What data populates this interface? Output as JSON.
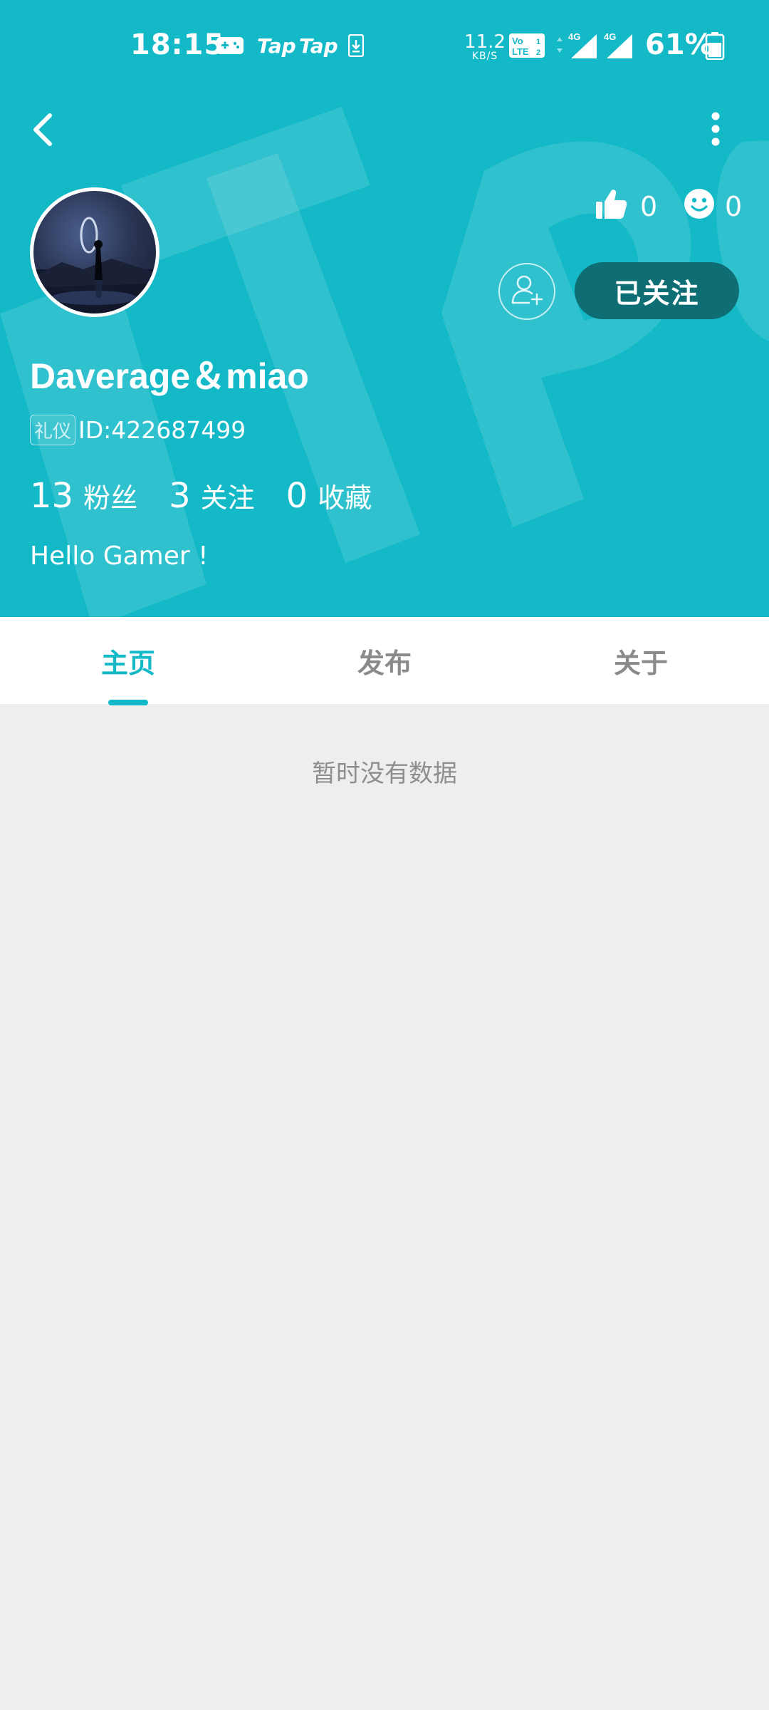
{
  "status_bar": {
    "time": "18:15",
    "notification_icons": [
      "gamepad-icon",
      "taptap-icon",
      "taptap-icon",
      "download-icon"
    ],
    "tap_label": "Tap",
    "net_speed_value": "11.2",
    "net_speed_unit": "KB/S",
    "network": "4G",
    "battery": "61%"
  },
  "nav": {
    "back_icon": "chevron-left-icon",
    "more_icon": "more-vertical-icon"
  },
  "profile": {
    "likes_count": "0",
    "smiles_count": "0",
    "follow_button": "已关注",
    "username": "Daverage＆miao",
    "badge": "礼仪",
    "id_text": "ID:422687499",
    "stats": [
      {
        "value": "13",
        "label": "粉丝"
      },
      {
        "value": "3",
        "label": "关注"
      },
      {
        "value": "0",
        "label": "收藏"
      }
    ],
    "bio": "Hello Gamer !"
  },
  "tabs": [
    {
      "label": "主页",
      "active": true
    },
    {
      "label": "发布",
      "active": false
    },
    {
      "label": "关于",
      "active": false
    }
  ],
  "content": {
    "empty_message": "暂时没有数据"
  },
  "colors": {
    "accent": "#14b9c8",
    "follow_button_bg": "#0f6e73",
    "page_bg": "#eeeeee"
  }
}
